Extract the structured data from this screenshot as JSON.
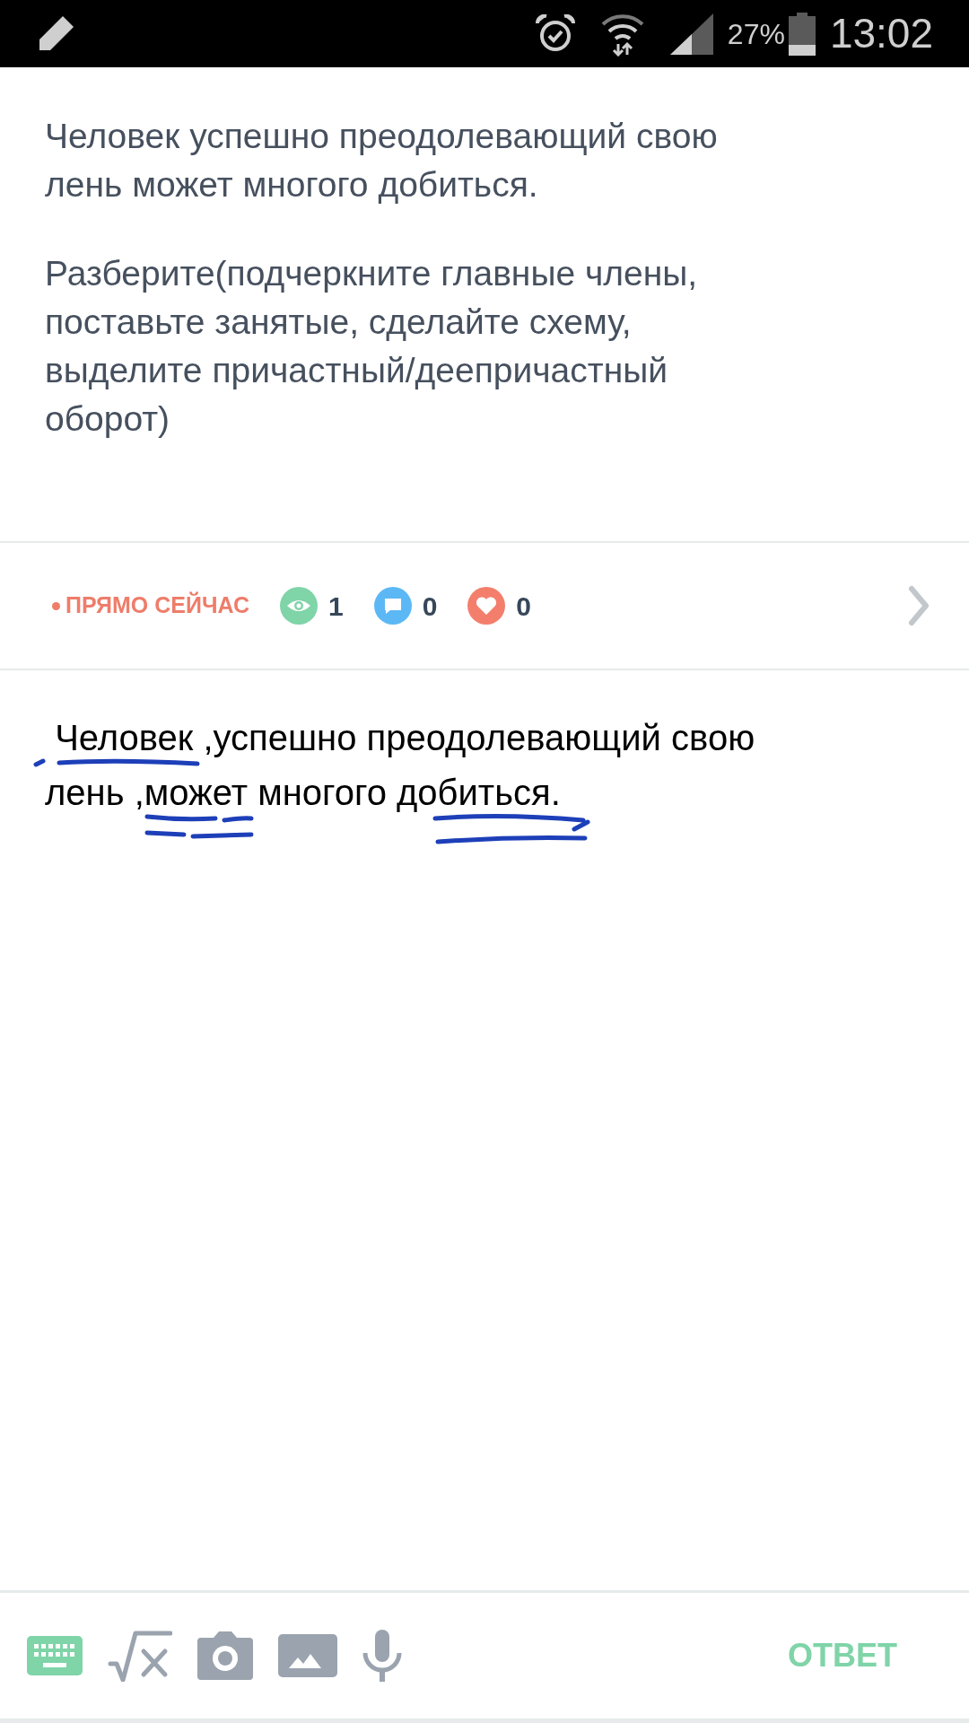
{
  "status_bar": {
    "battery": "27%",
    "time": "13:02"
  },
  "question": {
    "paragraphs": [
      "Человек успешно преодолевающий свою лень может многого добиться.",
      "Разберите(подчеркните главные члены, поставьте занятые, сделайте схему, выделите причастный/деепричастный оборот)"
    ]
  },
  "meta": {
    "status": "ПРЯМО СЕЙЧАС",
    "stats": [
      {
        "kind": "views",
        "count": "1"
      },
      {
        "kind": "comments",
        "count": "0"
      },
      {
        "kind": "likes",
        "count": "0"
      }
    ]
  },
  "answer": {
    "value": " Человек ,успешно преодолевающий свою лень ,может многого добиться."
  },
  "toolbar": {
    "tools": [
      {
        "kind": "keyboard",
        "selected": true
      },
      {
        "kind": "formula",
        "selected": false
      },
      {
        "kind": "camera",
        "selected": false
      },
      {
        "kind": "image",
        "selected": false
      },
      {
        "kind": "microphone",
        "selected": false
      }
    ],
    "submit": "ОТВЕТ"
  }
}
